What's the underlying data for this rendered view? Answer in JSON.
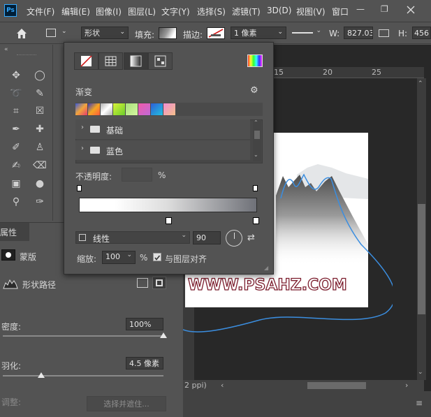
{
  "app": {
    "logo": "Ps"
  },
  "menubar": {
    "items": [
      "文件(F)",
      "编辑(E)",
      "图像(I)",
      "图层(L)",
      "文字(Y)",
      "选择(S)",
      "滤镜(T)",
      "3D(D)",
      "视图(V)",
      "窗口"
    ],
    "window_controls": {
      "minimize": "—",
      "restore": "❐"
    }
  },
  "options_bar": {
    "shape_mode": "形状",
    "fill_label": "填充:",
    "stroke_label": "描边:",
    "stroke_width": "1 像素",
    "width_label": "W:",
    "width_value": "827.03",
    "height_label": "H:",
    "height_value": "456"
  },
  "tools": {
    "icons": [
      "move-icon",
      "ellipse-marquee-icon",
      "lasso-icon",
      "quick-select-icon",
      "crop-icon",
      "frame-icon",
      "eyedropper-icon",
      "healing-brush-icon",
      "brush-icon",
      "clone-stamp-icon",
      "history-brush-icon",
      "eraser-icon",
      "gradient-icon",
      "blur-icon",
      "dodge-icon",
      "pen-icon"
    ]
  },
  "properties": {
    "tab_label": "属性",
    "mask_label": "蒙版",
    "layer_type": "形状路径",
    "density_label": "密度:",
    "density_value": "100%",
    "feather_label": "羽化:",
    "feather_value": "4.5 像素",
    "refine_label": "调整:",
    "select_mask_button": "选择并遮住..."
  },
  "canvas": {
    "ruler_ticks": [
      "15",
      "20",
      "25"
    ],
    "watermark": "WWW.PSAHZ.COM",
    "status_text": "2 ppi)"
  },
  "gradient_popup": {
    "title": "渐变",
    "folders": [
      "基础",
      "蓝色"
    ],
    "opacity_label": "不透明度:",
    "opacity_unit": "%",
    "style_value": "线性",
    "angle_value": "90",
    "scale_label": "缩放:",
    "scale_value": "100",
    "scale_unit": "%",
    "align_label": "与图层对齐",
    "align_checked": true
  },
  "colors": {
    "panel_bg": "#535353",
    "canvas_bg": "#282828",
    "path_stroke": "#3b8ee0",
    "watermark_fill": "#ffffff",
    "watermark_outline": "#7b1c2c"
  }
}
